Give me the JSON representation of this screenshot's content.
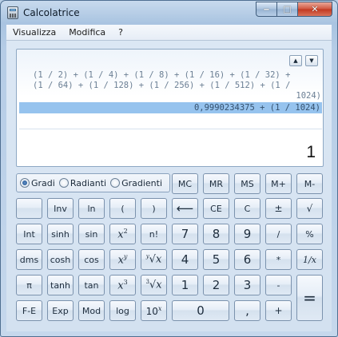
{
  "window": {
    "title": "Calcolatrice",
    "min_glyph": "‒",
    "max_glyph": "□",
    "close_glyph": "✕"
  },
  "menu": [
    "Visualizza",
    "Modifica",
    "?"
  ],
  "display": {
    "history_up": "▲",
    "history_down": "▼",
    "expression_lines": [
      "(1 / 2) + (1 / 4) + (1 / 8) + (1 / 16) + (1 / 32) +",
      "(1 / 64) + (1 / 128) + (1 / 256) + (1 / 512) + (1 /",
      "1024)"
    ],
    "current_expression": "0,9990234375 + (1 / 1024)",
    "value": "1"
  },
  "angle_units": {
    "options": [
      "Gradi",
      "Radianti",
      "Gradienti"
    ],
    "selected": "Gradi"
  },
  "buttons": {
    "mc": "MC",
    "mr": "MR",
    "ms": "MS",
    "mplus": "M+",
    "mminus": "M-",
    "inv": "Inv",
    "ln": "ln",
    "lparen": "(",
    "rparen": ")",
    "backspace": "⟵",
    "ce": "CE",
    "c": "C",
    "plusminus": "±",
    "sqrt": "√",
    "int": "Int",
    "sinh": "sinh",
    "sin": "sin",
    "x2_base": "x",
    "x2_exp": "2",
    "factorial": "n!",
    "d7": "7",
    "d8": "8",
    "d9": "9",
    "divide": "/",
    "percent": "%",
    "dms": "dms",
    "cosh": "cosh",
    "cos": "cos",
    "xy_base": "x",
    "xy_exp": "y",
    "yroot": "∛𝑥",
    "yroot_idx": "y",
    "yroot_x": "x",
    "d4": "4",
    "d5": "5",
    "d6": "6",
    "multiply": "*",
    "reciprocal": "1/x",
    "pi": "π",
    "tanh": "tanh",
    "tan": "tan",
    "x3_base": "x",
    "x3_exp": "3",
    "cbrt_idx": "3",
    "cbrt_x": "x",
    "d1": "1",
    "d2": "2",
    "d3": "3",
    "minus": "-",
    "equals": "=",
    "fe": "F-E",
    "exp": "Exp",
    "mod": "Mod",
    "log": "log",
    "tenx_base": "10",
    "tenx_exp": "x",
    "d0": "0",
    "decimal": ",",
    "plus": "+"
  },
  "colors": {
    "accent_highlight": "#96c3ee",
    "frame": "#b9cfe6"
  }
}
